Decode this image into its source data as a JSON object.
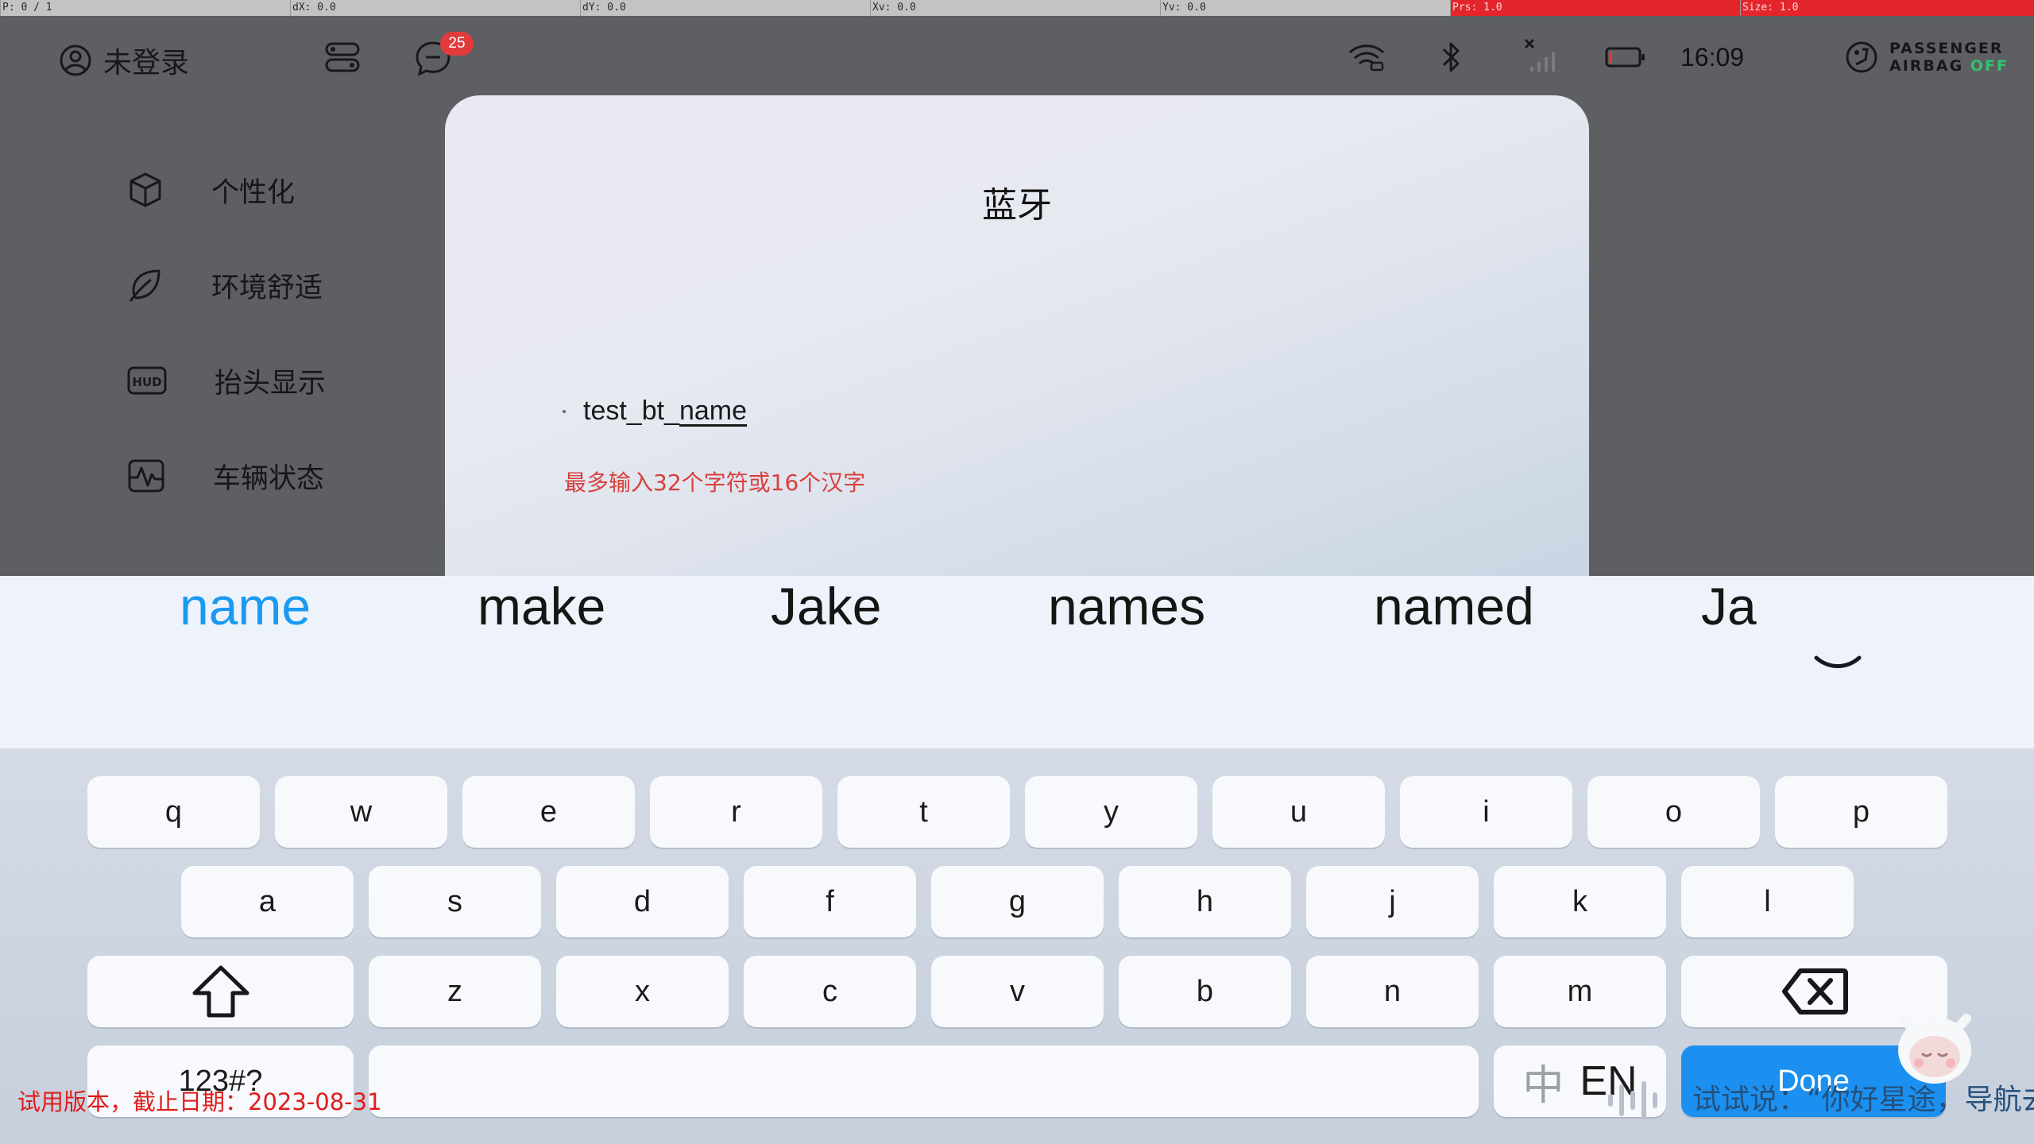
{
  "debug_bar": {
    "p": "P: 0 / 1",
    "dx": "dX: 0.0",
    "dy": "dY: 0.0",
    "xv": "Xv: 0.0",
    "yv": "Yv: 0.0",
    "prs": "Prs: 1.0",
    "size": "Size: 1.0"
  },
  "status_bar": {
    "user_label": "未登录",
    "message_badge": "25",
    "time": "16:09",
    "airbag_line1": "PASSENGER",
    "airbag_line2": "AIRBAG",
    "airbag_state": "OFF",
    "icons": [
      "user-icon",
      "toggle-icon",
      "message-icon",
      "wifi-icon",
      "bluetooth-icon",
      "cellular-off-icon",
      "battery-icon",
      "airbag-icon"
    ]
  },
  "side_menu": {
    "items": [
      {
        "label": "个性化",
        "icon": "cube-icon"
      },
      {
        "label": "环境舒适",
        "icon": "leaf-icon"
      },
      {
        "label": "抬头显示",
        "icon": "hud-icon"
      },
      {
        "label": "车辆状态",
        "icon": "vehicle-status-icon"
      }
    ]
  },
  "dialog": {
    "title": "蓝牙",
    "input_prefix": "test_bt_",
    "input_composing": "name",
    "hint": "最多输入32个字符或16个汉字"
  },
  "suggestions": {
    "words": [
      "name",
      "make",
      "Jake",
      "names",
      "named",
      "Ja"
    ]
  },
  "keyboard": {
    "row1": [
      "q",
      "w",
      "e",
      "r",
      "t",
      "y",
      "u",
      "i",
      "o",
      "p"
    ],
    "row2": [
      "a",
      "s",
      "d",
      "f",
      "g",
      "h",
      "j",
      "k",
      "l"
    ],
    "row3": [
      "z",
      "x",
      "c",
      "v",
      "b",
      "n",
      "m"
    ],
    "symbols_label": "123#?",
    "lang_zh": "中",
    "lang_en": "EN",
    "done_label": "Done"
  },
  "overlay": {
    "trial_notice": "试用版本，截止日期：2023-08-31",
    "voice_hint": "试试说：“你好星途，导航去"
  },
  "colors": {
    "accent": "#1a9af2",
    "hint_red": "#d8403d",
    "badge_red": "#e23b3b",
    "airbag_off": "#35c26f"
  }
}
